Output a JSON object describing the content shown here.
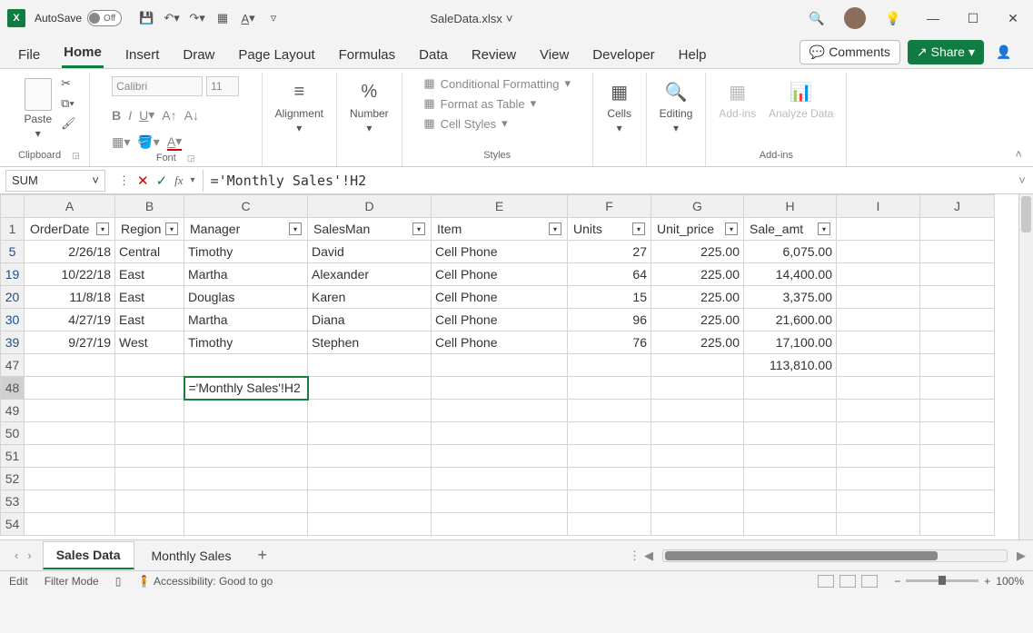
{
  "title": {
    "autosave": "AutoSave",
    "autosave_state": "Off",
    "filename": "SaleData.xlsx"
  },
  "tabs": {
    "file": "File",
    "home": "Home",
    "insert": "Insert",
    "draw": "Draw",
    "page": "Page Layout",
    "formulas": "Formulas",
    "data": "Data",
    "review": "Review",
    "view": "View",
    "developer": "Developer",
    "help": "Help",
    "comments": "Comments",
    "share": "Share"
  },
  "ribbon": {
    "clipboard": "Clipboard",
    "paste": "Paste",
    "font": "Font",
    "font_name": "Calibri",
    "font_size": "11",
    "alignment": "Alignment",
    "number": "Number",
    "styles": "Styles",
    "cond": "Conditional Formatting",
    "table": "Format as Table",
    "cell": "Cell Styles",
    "cells": "Cells",
    "editing": "Editing",
    "addins_grp": "Add-ins",
    "addins": "Add-ins",
    "analyze": "Analyze Data"
  },
  "formula": {
    "name_box": "SUM",
    "value": "='Monthly Sales'!H2"
  },
  "cols": [
    "",
    "A",
    "B",
    "C",
    "D",
    "E",
    "F",
    "G",
    "H",
    "I",
    "J"
  ],
  "widths": [
    26,
    100,
    76,
    136,
    136,
    150,
    92,
    102,
    102,
    92,
    82
  ],
  "headers": {
    "a": "OrderDate",
    "b": "Region",
    "c": "Manager",
    "d": "SalesMan",
    "e": "Item",
    "f": "Units",
    "g": "Unit_price",
    "h": "Sale_amt"
  },
  "rows": [
    {
      "r": "5",
      "blue": true,
      "a": "2/26/18",
      "b": "Central",
      "c": "Timothy",
      "d": "David",
      "e": "Cell Phone",
      "f": "27",
      "g": "225.00",
      "h": "6,075.00"
    },
    {
      "r": "19",
      "blue": true,
      "a": "10/22/18",
      "b": "East",
      "c": "Martha",
      "d": "Alexander",
      "e": "Cell Phone",
      "f": "64",
      "g": "225.00",
      "h": "14,400.00"
    },
    {
      "r": "20",
      "blue": true,
      "a": "11/8/18",
      "b": "East",
      "c": "Douglas",
      "d": "Karen",
      "e": "Cell Phone",
      "f": "15",
      "g": "225.00",
      "h": "3,375.00"
    },
    {
      "r": "30",
      "blue": true,
      "a": "4/27/19",
      "b": "East",
      "c": "Martha",
      "d": "Diana",
      "e": "Cell Phone",
      "f": "96",
      "g": "225.00",
      "h": "21,600.00"
    },
    {
      "r": "39",
      "blue": true,
      "a": "9/27/19",
      "b": "West",
      "c": "Timothy",
      "d": "Stephen",
      "e": "Cell Phone",
      "f": "76",
      "g": "225.00",
      "h": "17,100.00"
    }
  ],
  "total_row": {
    "r": "47",
    "h": "113,810.00"
  },
  "edit_row": {
    "r": "48",
    "c": "='Monthly Sales'!H2"
  },
  "empty_rows": [
    "49",
    "50",
    "51",
    "52",
    "53",
    "54"
  ],
  "sheets": {
    "active": "Sales Data",
    "other": "Monthly Sales"
  },
  "status": {
    "edit": "Edit",
    "filter": "Filter Mode",
    "access": "Accessibility: Good to go",
    "zoom": "100%"
  }
}
